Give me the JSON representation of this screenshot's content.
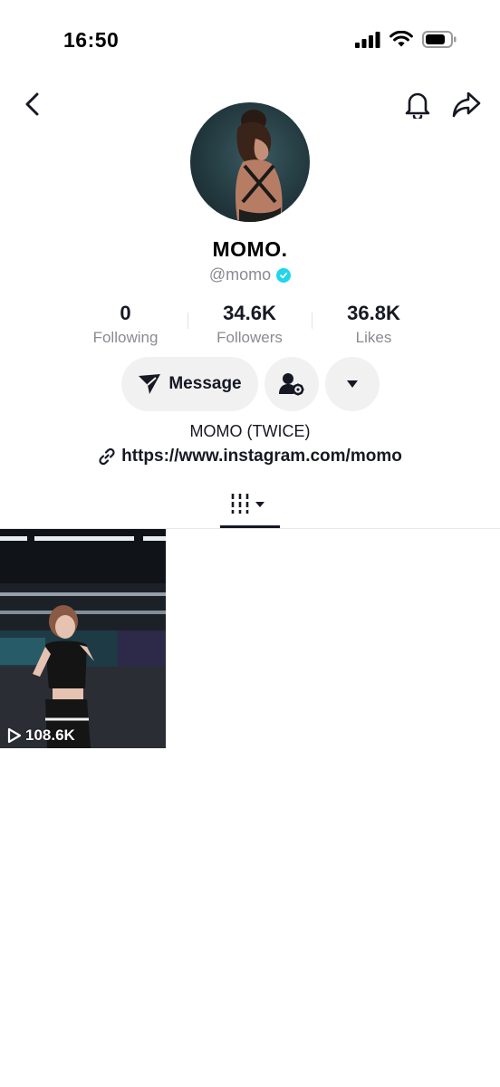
{
  "status": {
    "time": "16:50"
  },
  "profile": {
    "display_name": "MOMO.",
    "username": "@momo",
    "bio": "MOMO (TWICE)",
    "link": "https://www.instagram.com/momo"
  },
  "stats": [
    {
      "value": "0",
      "label": "Following"
    },
    {
      "value": "34.6K",
      "label": "Followers"
    },
    {
      "value": "36.8K",
      "label": "Likes"
    }
  ],
  "actions": {
    "message_label": "Message"
  },
  "videos": [
    {
      "views": "108.6K"
    }
  ],
  "colors": {
    "verified": "#20d5ec",
    "button_bg": "#f1f1f2",
    "text_primary": "#161823",
    "text_secondary": "#8a8b91"
  },
  "icons": [
    "back-icon",
    "bell-icon",
    "share-icon",
    "send-icon",
    "user-settings-icon",
    "dropdown-icon",
    "link-icon",
    "grid-icon",
    "play-icon",
    "verified-icon"
  ]
}
